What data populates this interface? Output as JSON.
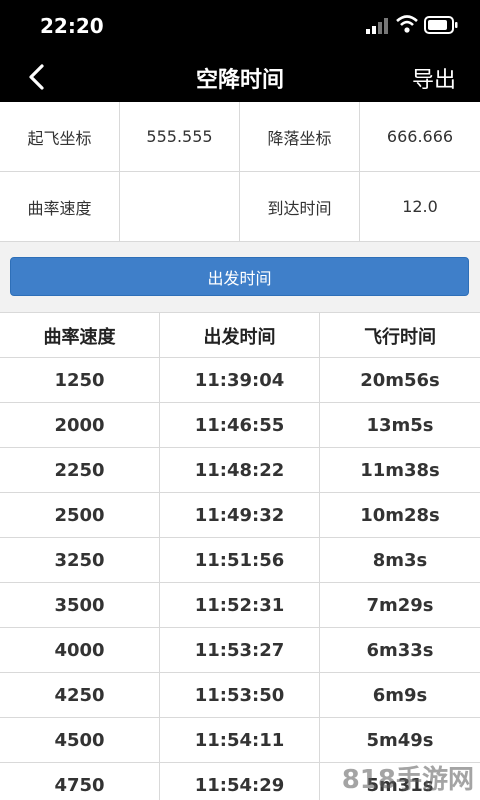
{
  "status": {
    "time": "22:20"
  },
  "nav": {
    "title": "空降时间",
    "export_label": "导出"
  },
  "form": {
    "takeoff_label": "起飞坐标",
    "takeoff_value": "555.555",
    "landing_label": "降落坐标",
    "landing_value": "666.666",
    "curve_label": "曲率速度",
    "curve_value": "",
    "arrive_label": "到达时间",
    "arrive_value": "12.0"
  },
  "depart_button": "出发时间",
  "table": {
    "headers": [
      "曲率速度",
      "出发时间",
      "飞行时间"
    ],
    "rows": [
      [
        "1250",
        "11:39:04",
        "20m56s"
      ],
      [
        "2000",
        "11:46:55",
        "13m5s"
      ],
      [
        "2250",
        "11:48:22",
        "11m38s"
      ],
      [
        "2500",
        "11:49:32",
        "10m28s"
      ],
      [
        "3250",
        "11:51:56",
        "8m3s"
      ],
      [
        "3500",
        "11:52:31",
        "7m29s"
      ],
      [
        "4000",
        "11:53:27",
        "6m33s"
      ],
      [
        "4250",
        "11:53:50",
        "6m9s"
      ],
      [
        "4500",
        "11:54:11",
        "5m49s"
      ],
      [
        "4750",
        "11:54:29",
        "5m31s"
      ]
    ]
  },
  "watermark": "818手游网",
  "colors": {
    "accent": "#3f7fc9",
    "header_bg": "#000000"
  }
}
